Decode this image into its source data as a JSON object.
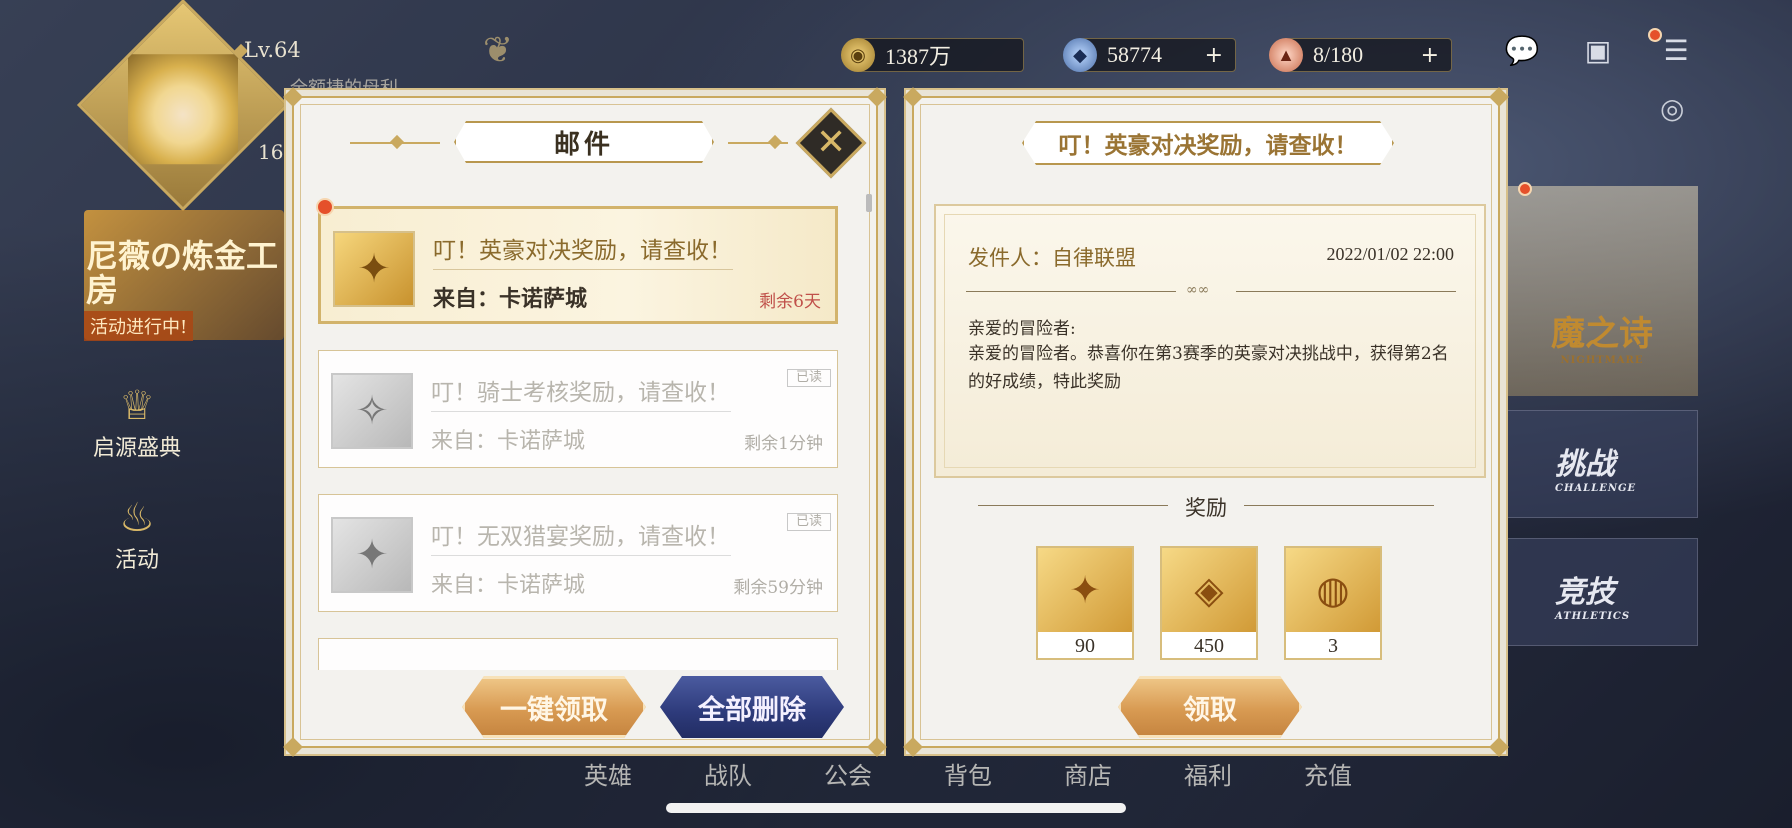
{
  "hud": {
    "level": "Lv.64",
    "player_name": "全额捷的母利",
    "friends_count": "16",
    "resources": [
      {
        "icon": "gold-coin-icon",
        "value": "1387万",
        "has_plus": false
      },
      {
        "icon": "gem-icon",
        "value": "58774",
        "has_plus": true
      },
      {
        "icon": "stamina-cake-icon",
        "value": "8/180",
        "has_plus": true
      }
    ]
  },
  "left_side": {
    "event_banner": {
      "title": "尼薇の炼金工房",
      "subtitle": "活动进行中!"
    },
    "buttons": [
      {
        "label": "启源盛典",
        "icon": "cup-icon"
      },
      {
        "label": "活动",
        "icon": "bag-icon"
      }
    ]
  },
  "right_side": {
    "nightmare": {
      "title": "魔之诗",
      "sub": "NIGHTMARE"
    },
    "challenge": {
      "title": "挑战",
      "sub": "CHALLENGE"
    },
    "athletics": {
      "title": "竞技",
      "sub": "ATHLETICS"
    }
  },
  "bottom_nav": [
    "英雄",
    "战队",
    "公会",
    "背包",
    "商店",
    "福利",
    "充值"
  ],
  "mail_panel": {
    "title": "邮件",
    "close_symbol": "✕",
    "items": [
      {
        "subject": "叮！英豪对决奖励，请查收！",
        "sender": "来自：卡诺萨城",
        "remaining": "剩余6天",
        "read": false,
        "read_tag": ""
      },
      {
        "subject": "叮！骑士考核奖励，请查收！",
        "sender": "来自：卡诺萨城",
        "remaining": "剩余1分钟",
        "read": true,
        "read_tag": "已读"
      },
      {
        "subject": "叮！无双猎宴奖励，请查收！",
        "sender": "来自：卡诺萨城",
        "remaining": "剩余59分钟",
        "read": true,
        "read_tag": "已读"
      }
    ],
    "claim_all_label": "一键领取",
    "delete_all_label": "全部删除"
  },
  "detail_panel": {
    "title": "叮！英豪对决奖励，请查收！",
    "sender": "发件人：自律联盟",
    "date": "2022/01/02 22:00",
    "greeting": "亲爱的冒险者:",
    "body": "亲爱的冒险者。恭喜你在第3赛季的英豪对决挑战中，获得第2名的好成绩，特此奖励",
    "rewards_label": "奖励",
    "rewards": [
      {
        "icon": "puzzle-piece-icon",
        "count": "90"
      },
      {
        "icon": "amber-gem-icon",
        "count": "450"
      },
      {
        "icon": "ring-icon",
        "count": "3"
      }
    ],
    "claim_label": "领取"
  }
}
